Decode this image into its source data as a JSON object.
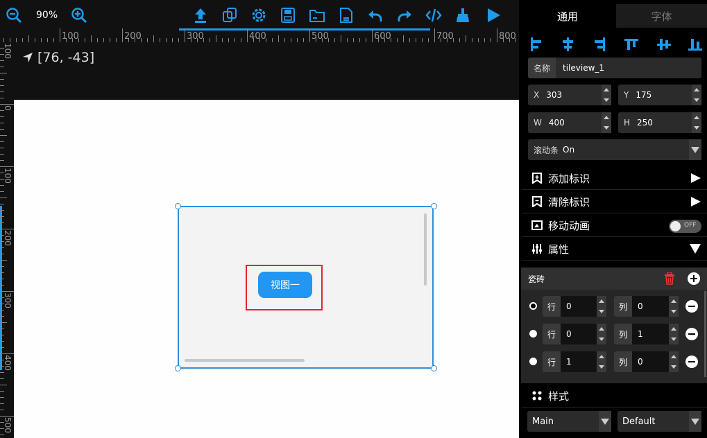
{
  "toolbar": {
    "zoom_level": "90%",
    "tools": [
      "zoom-out",
      "zoom-in",
      "upload",
      "copy",
      "settings",
      "save",
      "open-folder",
      "file",
      "undo",
      "redo",
      "code",
      "clean",
      "run"
    ]
  },
  "ruler": {
    "top_labels": [
      "100",
      "200",
      "300",
      "400",
      "500",
      "600",
      "700",
      "800"
    ],
    "left_labels": [
      "100",
      "200",
      "300",
      "400",
      "500"
    ],
    "top_left_label": "100",
    "left_zero": "0"
  },
  "cursor_coords": "[76, -43]",
  "canvas": {
    "view_button_label": "视图一"
  },
  "panel": {
    "tabs": [
      {
        "label": "通用"
      },
      {
        "label": "字体"
      }
    ],
    "name_label": "名称",
    "name_value": "tileview_1",
    "x_label": "X",
    "x_value": "303",
    "y_label": "Y",
    "y_value": "175",
    "w_label": "W",
    "w_value": "400",
    "h_label": "H",
    "h_value": "250",
    "scrollbar_label": "滚动条",
    "scrollbar_value": "On",
    "add_marker": "添加标识",
    "clear_marker": "清除标识",
    "move_animation": "移动动画",
    "toggle_text": "OFF",
    "properties": "属性",
    "tiles_title": "瓷砖",
    "row_label": "行",
    "col_label": "列",
    "tiles": [
      {
        "row": "0",
        "col": "0",
        "selected": true
      },
      {
        "row": "0",
        "col": "1",
        "selected": false
      },
      {
        "row": "1",
        "col": "0",
        "selected": false
      }
    ],
    "style_title": "样式",
    "style_part": "Main",
    "style_state": "Default"
  },
  "colors": {
    "accent": "#1e9bea",
    "button_blue": "#2196f3",
    "selection_red": "#e0262e",
    "delete_red": "#e53935"
  }
}
